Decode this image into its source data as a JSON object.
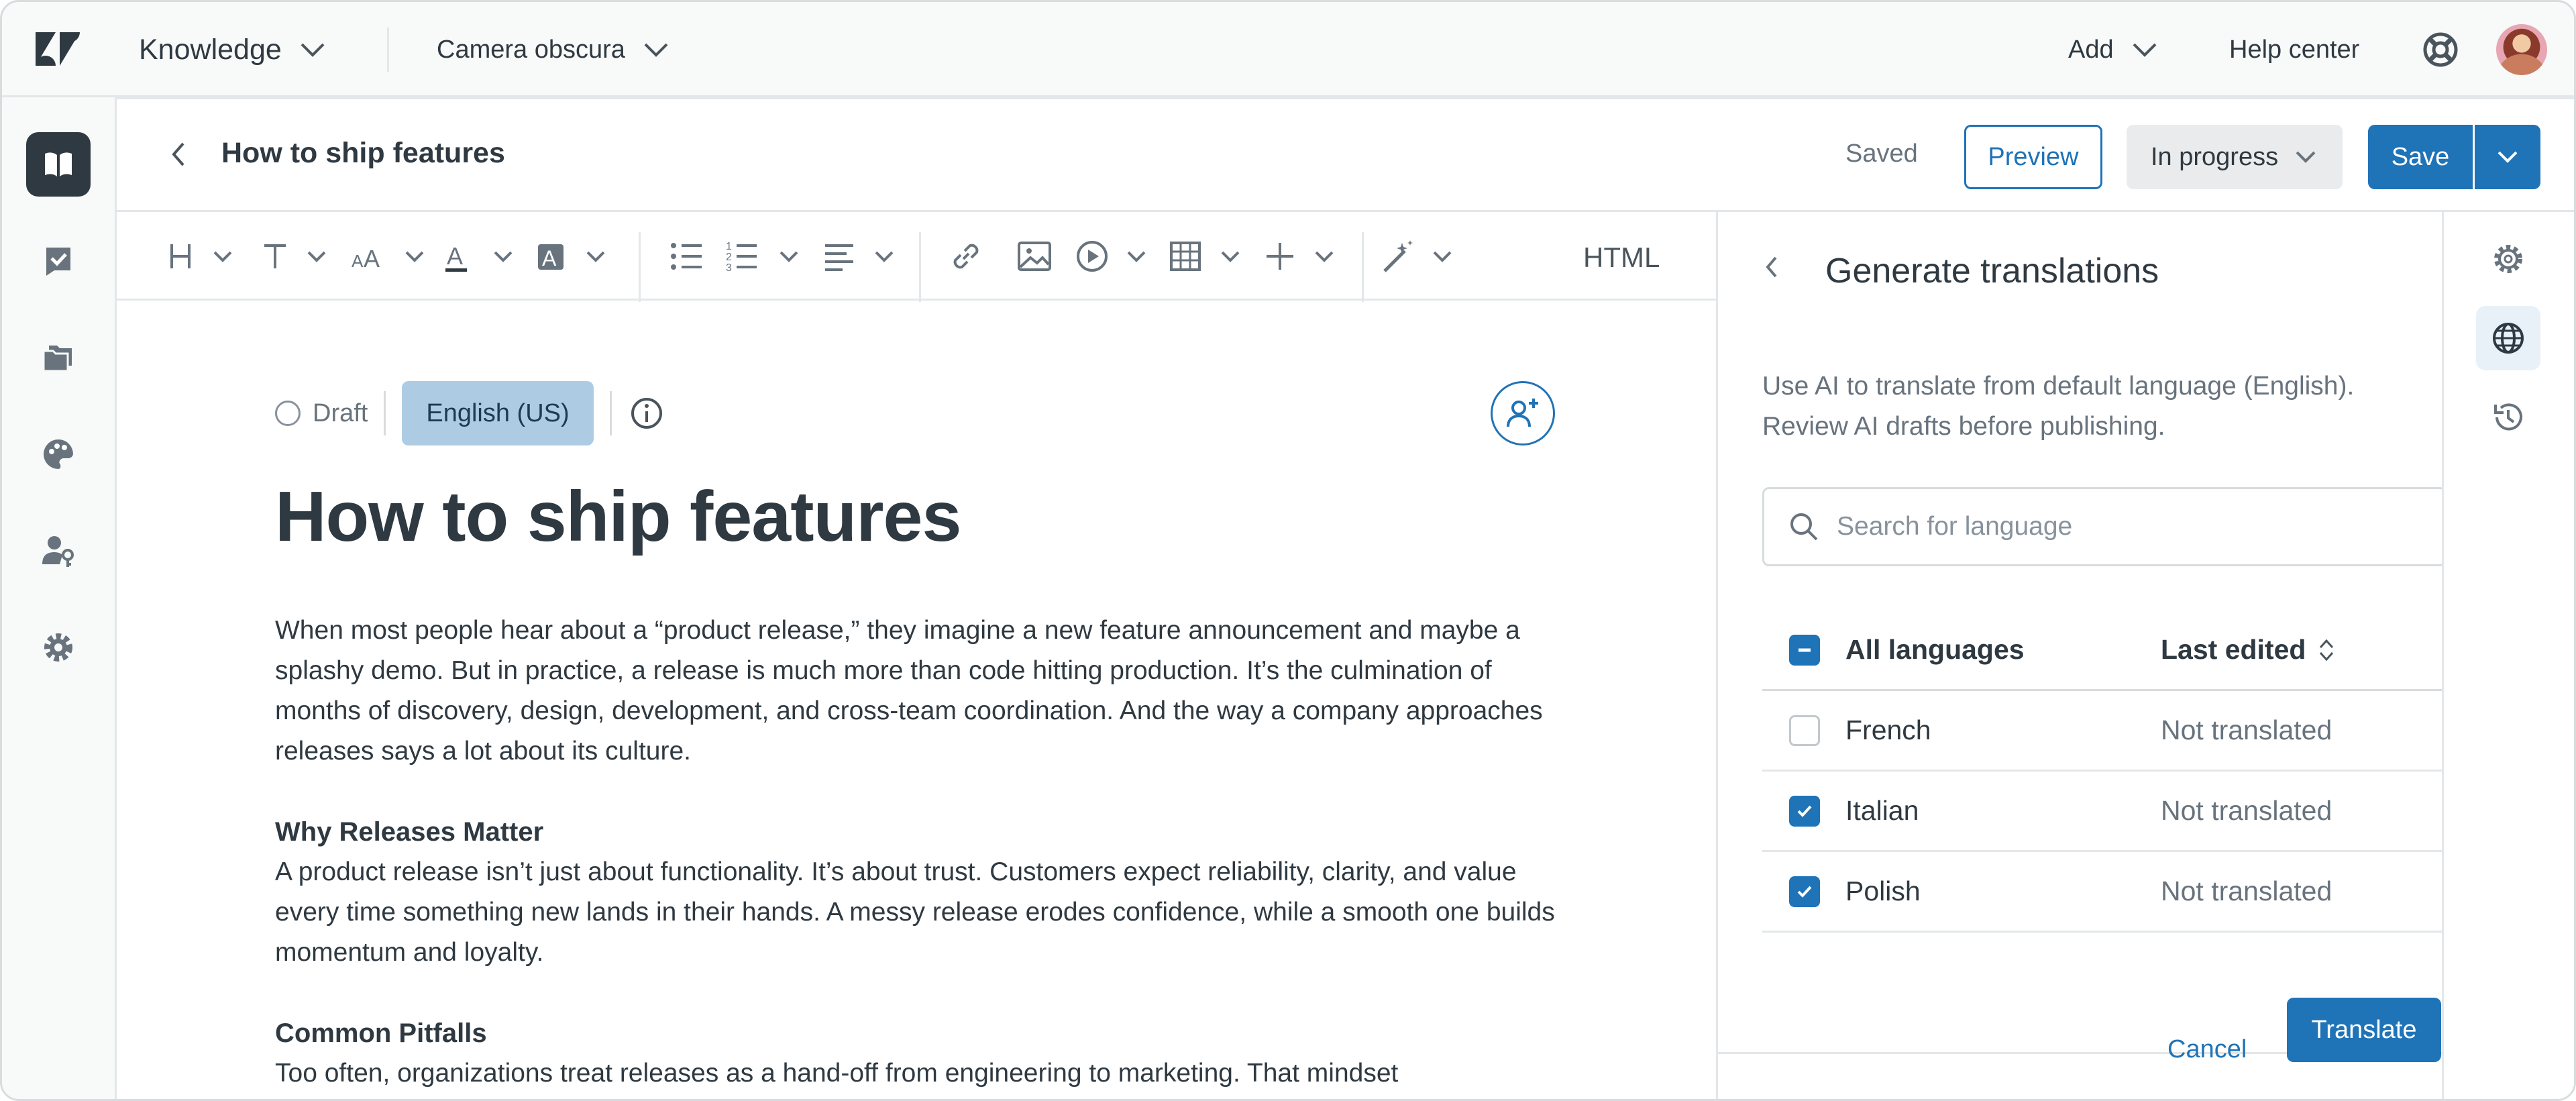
{
  "topbar": {
    "product_label": "Knowledge",
    "brand_label": "Camera obscura",
    "add_label": "Add",
    "help_center_label": "Help center"
  },
  "leftnav": {
    "items": [
      {
        "icon": "book-icon",
        "active": true
      },
      {
        "icon": "task-check-icon",
        "active": false
      },
      {
        "icon": "folders-icon",
        "active": false
      },
      {
        "icon": "palette-icon",
        "active": false
      },
      {
        "icon": "user-permissions-icon",
        "active": false
      },
      {
        "icon": "gear-icon",
        "active": false
      }
    ]
  },
  "header": {
    "article_title": "How to ship features",
    "saved_label": "Saved",
    "preview_label": "Preview",
    "status_label": "In progress",
    "save_label": "Save"
  },
  "toolbar": {
    "html_label": "HTML",
    "tools": [
      "heading",
      "text-style",
      "font-size",
      "text-color",
      "highlight",
      "bullet-list",
      "numbered-list",
      "align",
      "link",
      "image",
      "media",
      "table",
      "insert",
      "ai-assist"
    ]
  },
  "editor": {
    "draft_label": "Draft",
    "language_label": "English (US)",
    "title": "How to ship features",
    "paragraphs": [
      {
        "heading": "",
        "text": "When most people hear about a “product release,” they imagine a new feature announcement and maybe a splashy demo. But in practice, a release is much more than code hitting production. It’s the culmination of months of discovery, design, development, and cross-team coordination. And the way a company approaches releases says a lot about its culture."
      },
      {
        "heading": "Why Releases Matter",
        "text": "A product release isn’t just about functionality. It’s about trust. Customers expect reliability, clarity, and value every time something new lands in their hands. A messy release erodes confidence, while a smooth one builds momentum and loyalty."
      },
      {
        "heading": "Common Pitfalls",
        "text": "Too often, organizations treat releases as a hand-off from engineering to marketing. That mindset"
      }
    ]
  },
  "panel": {
    "title": "Generate translations",
    "description": "Use AI to translate from default language (English). Review AI drafts before publishing.",
    "search_placeholder": "Search for language",
    "header_all": "All languages",
    "header_last_edited": "Last edited",
    "languages": [
      {
        "name": "French",
        "status": "Not translated",
        "checked": false
      },
      {
        "name": "Italian",
        "status": "Not translated",
        "checked": true
      },
      {
        "name": "Polish",
        "status": "Not translated",
        "checked": true
      }
    ],
    "cancel_label": "Cancel",
    "translate_label": "Translate"
  },
  "rail": {
    "items": [
      {
        "icon": "gear-icon",
        "active": false
      },
      {
        "icon": "globe-icon",
        "active": true
      },
      {
        "icon": "history-icon",
        "active": false
      }
    ]
  },
  "colors": {
    "accent": "#1f73b7",
    "text": "#2f3941",
    "muted": "#68737d",
    "language_chip": "#adcce4",
    "nav_active": "#2f3941"
  }
}
